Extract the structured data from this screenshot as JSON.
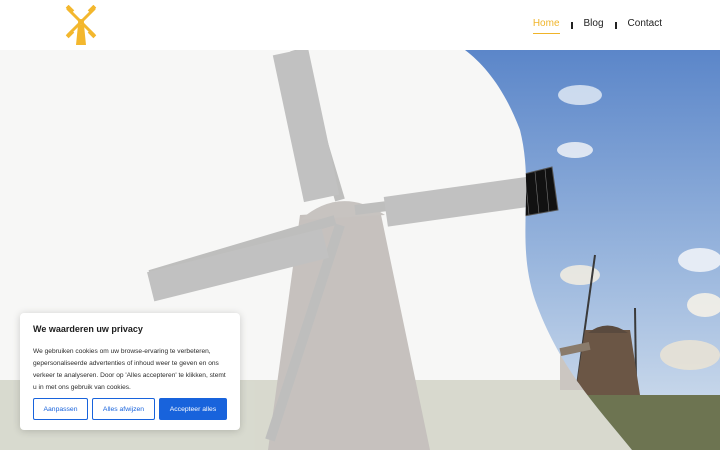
{
  "header": {
    "logo_icon": "windmill-logo-icon",
    "nav": [
      {
        "label": "Home",
        "active": true
      },
      {
        "label": "Blog",
        "active": false
      },
      {
        "label": "Contact",
        "active": false
      }
    ]
  },
  "hero": {
    "image": "windmill-photo"
  },
  "cookie_banner": {
    "title": "We waarderen uw privacy",
    "text": "We gebruiken cookies om uw browse-ervaring te verbeteren, gepersonaliseerde advertenties of inhoud weer te geven en ons verkeer te analyseren. Door op 'Alles accepteren' te klikken, stemt u in met ons gebruik van cookies.",
    "buttons": {
      "customize": "Aanpassen",
      "reject": "Alles afwijzen",
      "accept": "Accepteer alles"
    }
  },
  "colors": {
    "accent": "#f0b429",
    "button_blue": "#1863dc"
  }
}
